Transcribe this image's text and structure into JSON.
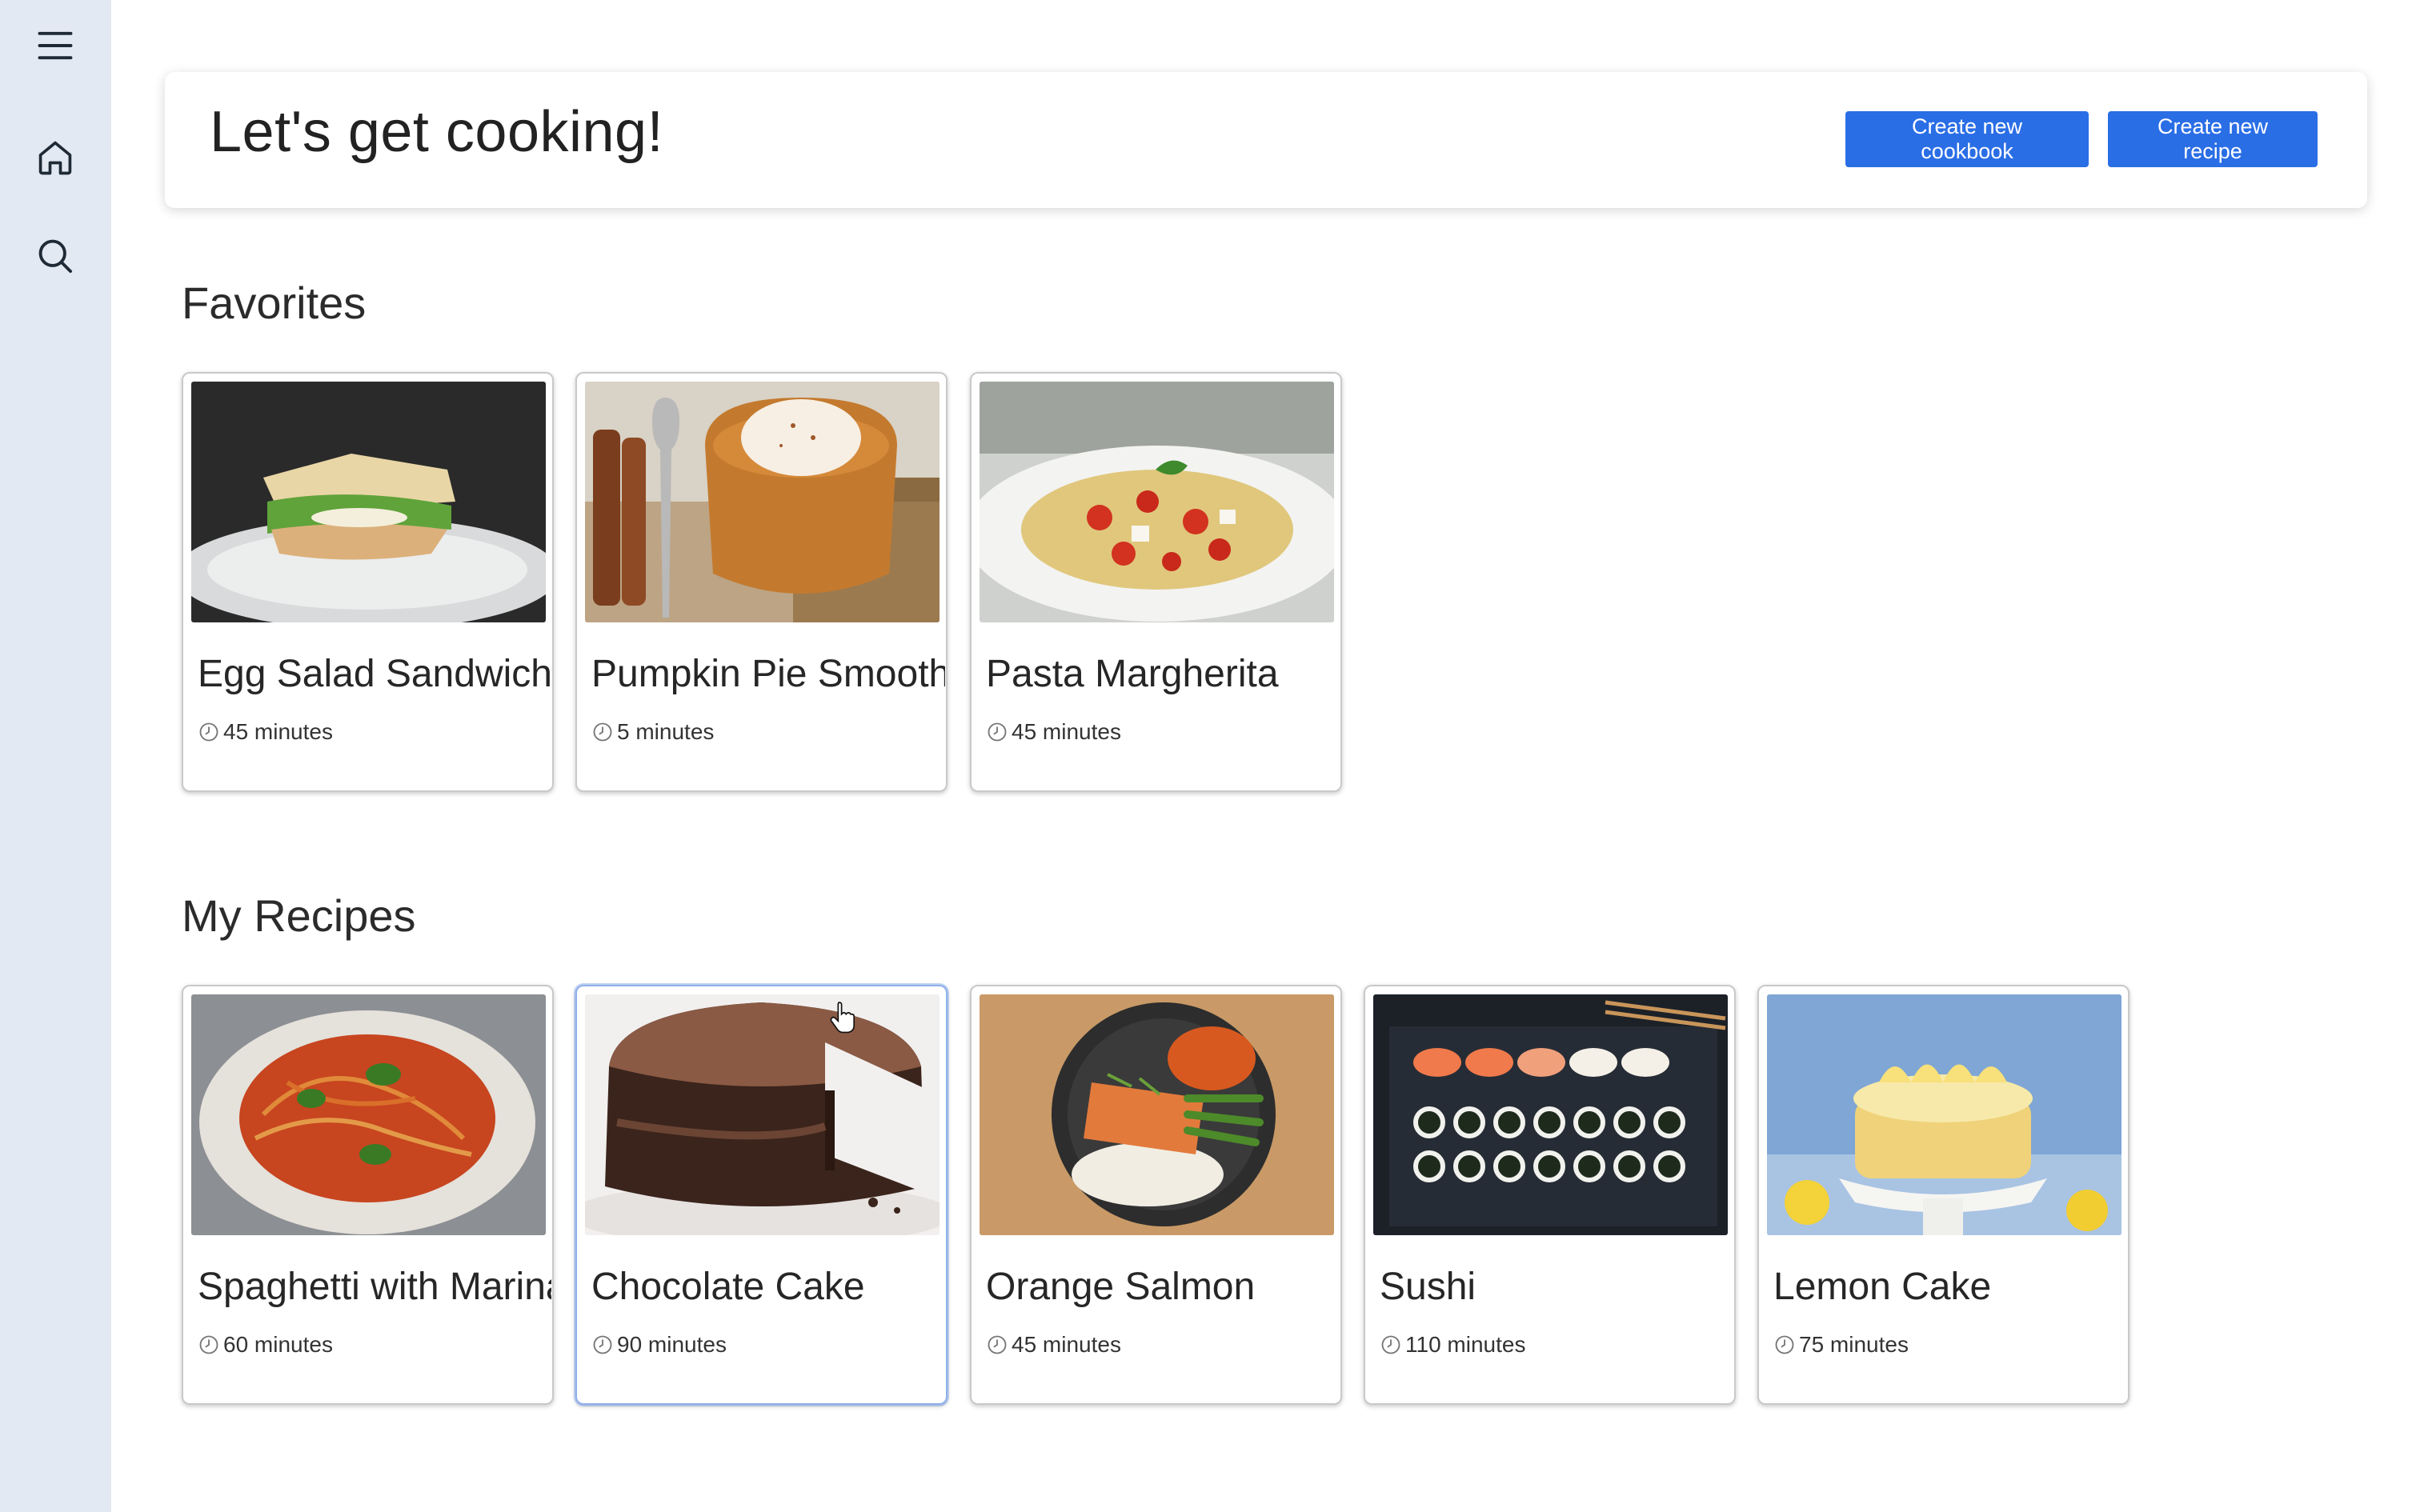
{
  "sidebar": {
    "items": [
      {
        "icon": "hamburger-menu-icon"
      },
      {
        "icon": "home-icon"
      },
      {
        "icon": "search-icon"
      }
    ]
  },
  "header": {
    "title": "Let's get cooking!",
    "create_cookbook_label": "Create new cookbook",
    "create_recipe_label": "Create new recipe",
    "button_color": "#2a6ee6"
  },
  "favorites": {
    "title": "Favorites",
    "cards": [
      {
        "name": "Egg Salad Sandwiches",
        "time": "45 minutes"
      },
      {
        "name": "Pumpkin Pie Smoothie",
        "time": "5 minutes"
      },
      {
        "name": "Pasta Margherita",
        "time": "45 minutes"
      }
    ]
  },
  "my_recipes": {
    "title": "My Recipes",
    "cards": [
      {
        "name": "Spaghetti with Marinara",
        "time": "60 minutes"
      },
      {
        "name": "Chocolate Cake",
        "time": "90 minutes"
      },
      {
        "name": "Orange Salmon",
        "time": "45 minutes"
      },
      {
        "name": "Sushi",
        "time": "110 minutes"
      },
      {
        "name": "Lemon Cake",
        "time": "75 minutes"
      }
    ]
  }
}
